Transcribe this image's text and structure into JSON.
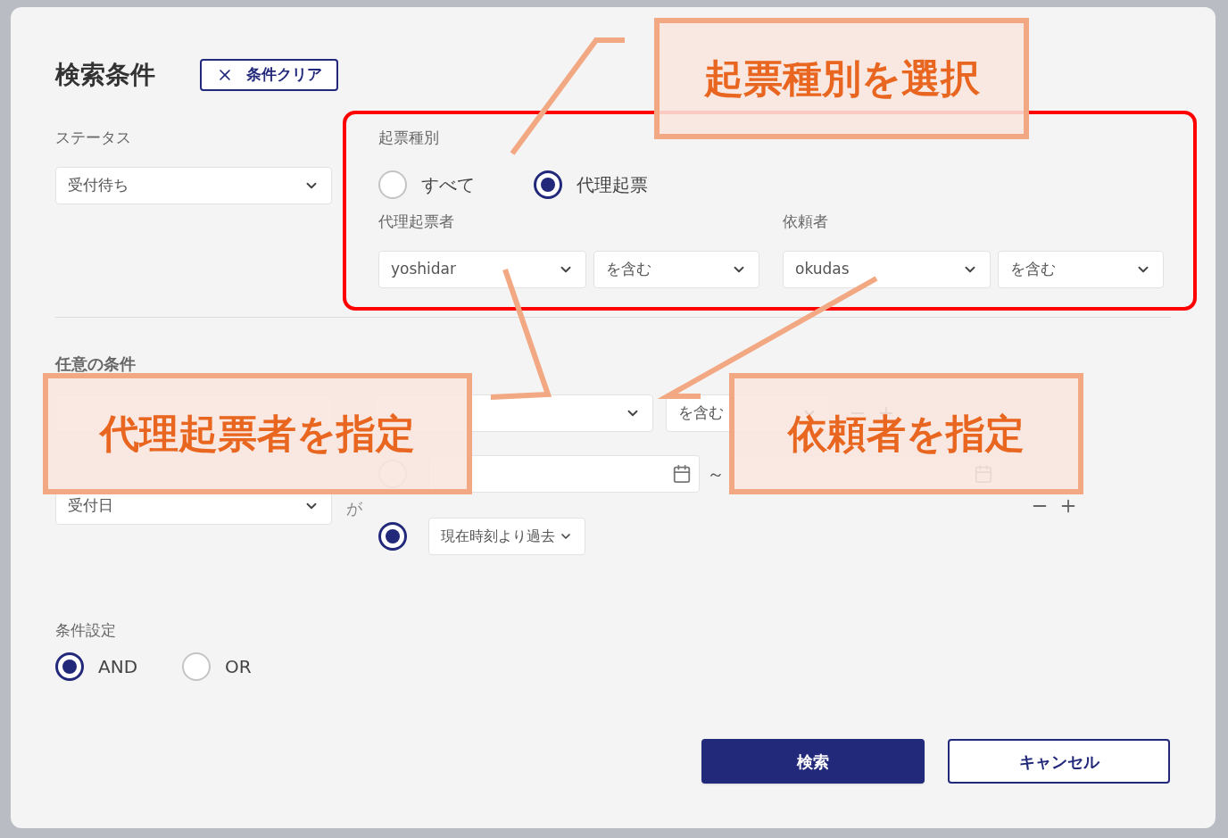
{
  "dialog": {
    "title": "検索条件",
    "clear_button": "条件クリア",
    "status": {
      "label": "ステータス",
      "value": "受付待ち"
    },
    "ticket_type": {
      "label": "起票種別",
      "options": [
        {
          "label": "すべて",
          "selected": false
        },
        {
          "label": "代理起票",
          "selected": true
        }
      ]
    },
    "proxy": {
      "label": "代理起票者",
      "value": "yoshidar",
      "match": "を含む"
    },
    "requester": {
      "label": "依頼者",
      "value": "okudas",
      "match": "を含む"
    },
    "optional": {
      "title": "任意の条件",
      "text_condition": {
        "match": "を含む"
      },
      "date_condition": {
        "field": "受付日",
        "particle": "が",
        "modes": [
          {
            "kind": "range",
            "selected": false,
            "separator": "～"
          },
          {
            "kind": "relative",
            "selected": true,
            "value": "現在時刻より過去"
          }
        ]
      }
    },
    "logic": {
      "label": "条件設定",
      "options": [
        {
          "label": "AND",
          "selected": true
        },
        {
          "label": "OR",
          "selected": false
        }
      ]
    },
    "buttons": {
      "search": "検索",
      "cancel": "キャンセル"
    }
  },
  "annotations": [
    {
      "text": "起票種別を選択"
    },
    {
      "text": "代理起票者を指定"
    },
    {
      "text": "依頼者を指定"
    }
  ]
}
